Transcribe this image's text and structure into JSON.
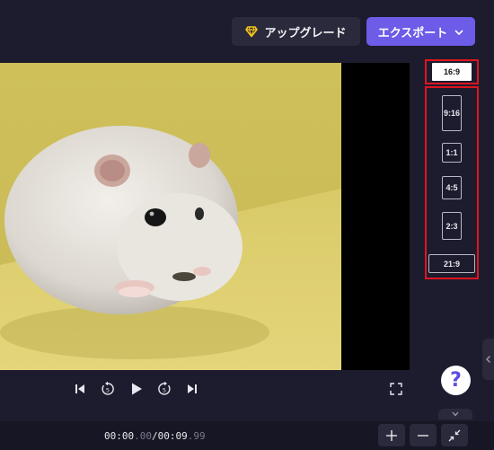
{
  "header": {
    "upgrade_label": "アップグレード",
    "export_label": "エクスポート"
  },
  "aspect_ratios": {
    "selected": "16:9",
    "options": [
      "9:16",
      "1:1",
      "4:5",
      "2:3",
      "21:9"
    ]
  },
  "player": {
    "current_time": "00:00",
    "current_frac": ".00",
    "separator": "/",
    "duration": "00:09",
    "duration_frac": ".99"
  },
  "help_label": "?",
  "colors": {
    "accent": "#6c5ce7",
    "highlight_box": "#e0141e",
    "background": "#1c1c2e"
  }
}
